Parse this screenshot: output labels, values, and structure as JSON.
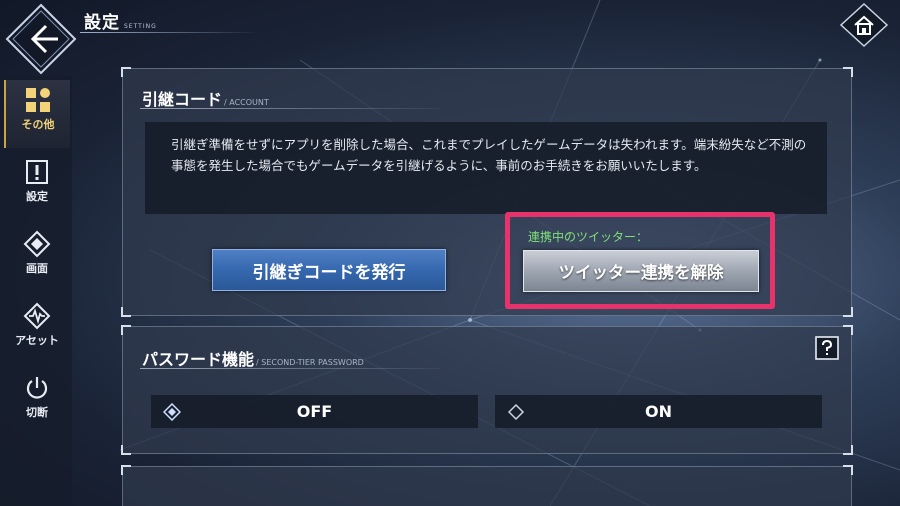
{
  "header": {
    "title": "設定",
    "title_sub": "SETTING",
    "back_icon": "back-arrow-icon",
    "home_icon": "home-icon"
  },
  "sidebar": {
    "items": [
      {
        "label": "その他",
        "icon": "grid-icon",
        "active": true
      },
      {
        "label": "設定",
        "icon": "alert-setting-icon",
        "active": false
      },
      {
        "label": "画面",
        "icon": "diamond-screen-icon",
        "active": false
      },
      {
        "label": "アセット",
        "icon": "wave-asset-icon",
        "active": false
      },
      {
        "label": "切断",
        "icon": "power-icon",
        "active": false
      }
    ]
  },
  "account_section": {
    "title": "引継コード",
    "subtitle": "/ ACCOUNT",
    "notice": "引継ぎ準備をせずにアプリを削除した場合、これまでプレイしたゲームデータは失われます。端末紛失など不測の事態を発生した場合でもゲームデータを引継げるように、事前のお手続きをお願いいたします。",
    "issue_button": "引継ぎコードを発行",
    "linked_label": "連携中のツイッター：",
    "unlink_button": "ツイッター連携を解除"
  },
  "password_section": {
    "title": "パスワード機能",
    "subtitle": "/ SECOND-TIER PASSWORD",
    "help_icon": "help-icon",
    "options": [
      {
        "label": "OFF",
        "selected": true
      },
      {
        "label": "ON",
        "selected": false
      }
    ]
  },
  "colors": {
    "accent_gold": "#f2d37a",
    "highlight_pink": "#e8326b",
    "linked_green": "#7fe07a",
    "button_blue": "#3466ad"
  }
}
